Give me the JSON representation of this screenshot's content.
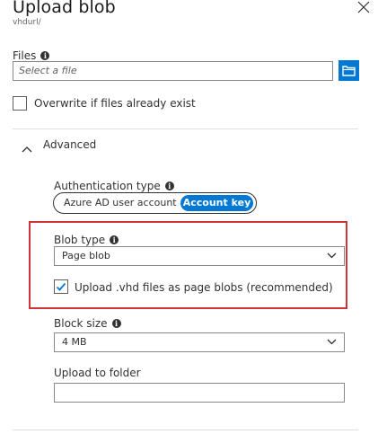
{
  "header": {
    "title": "Upload blob",
    "subtitle": "vhdurl/"
  },
  "files": {
    "label": "Files",
    "placeholder": "Select a file",
    "browse_icon": "folder-icon"
  },
  "overwrite": {
    "label": "Overwrite if files already exist",
    "checked": false
  },
  "advanced": {
    "label": "Advanced",
    "expanded": true
  },
  "auth": {
    "label": "Authentication type",
    "options": [
      "Azure AD user account",
      "Account key"
    ],
    "selected": "Account key"
  },
  "blob_type": {
    "label": "Blob type",
    "value": "Page blob"
  },
  "upload_vhd": {
    "label": "Upload .vhd files as page blobs (recommended)",
    "checked": true
  },
  "block_size": {
    "label": "Block size",
    "value": "4 MB"
  },
  "upload_folder": {
    "label": "Upload to folder",
    "value": ""
  },
  "colors": {
    "accent": "#0078d4",
    "highlight_border": "#d13438"
  }
}
